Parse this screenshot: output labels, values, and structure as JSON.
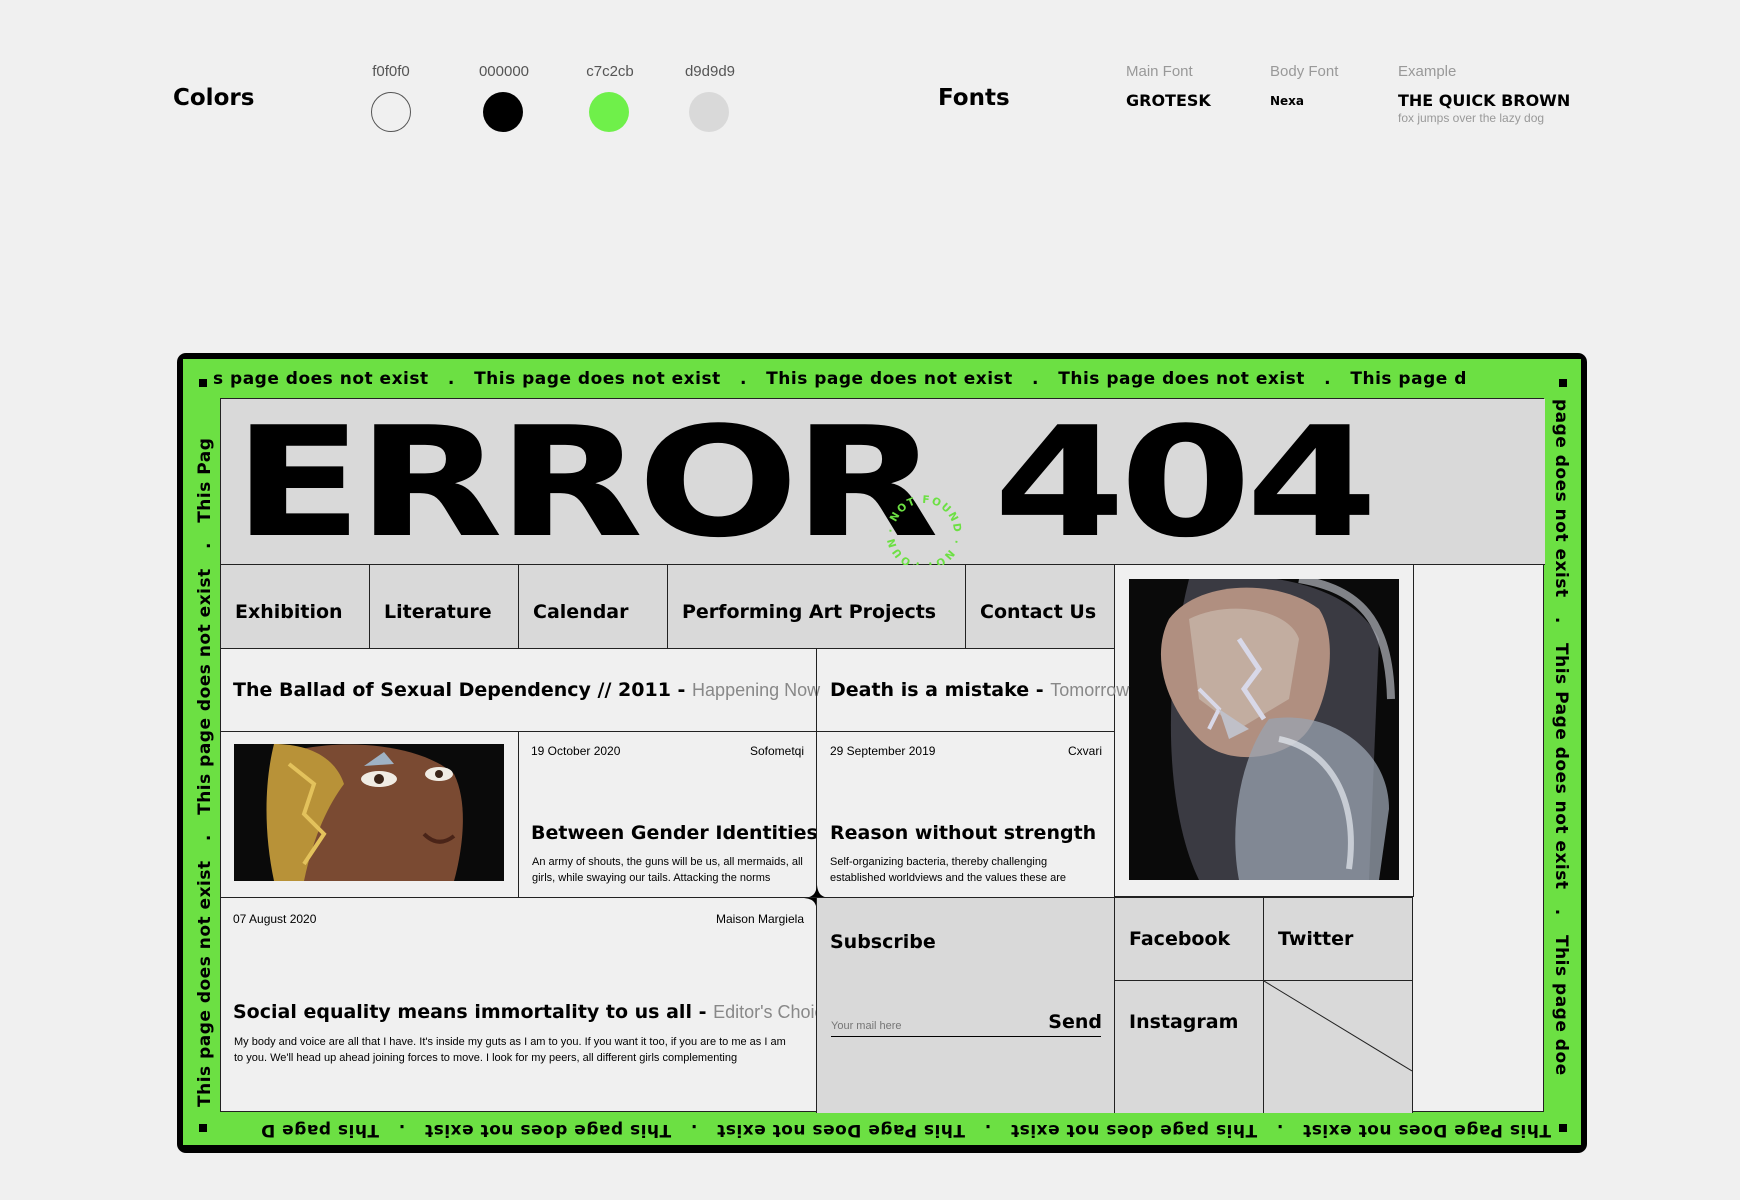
{
  "guide": {
    "colors_title": "Colors",
    "swatches": [
      {
        "label": "f0f0f0",
        "color": "#f0f0f0"
      },
      {
        "label": "000000",
        "color": "#000000"
      },
      {
        "label": "c7c2cb",
        "color": "#6ff04a"
      },
      {
        "label": "d9d9d9",
        "color": "#d9d9d9"
      }
    ],
    "fonts_title": "Fonts",
    "main_font_label": "Main Font",
    "main_font_value": "GROTESK",
    "body_font_label": "Body Font",
    "body_font_value": "Nexa",
    "example_label": "Example",
    "example_heading": "THE QUICK BROWN",
    "example_body": "fox jumps over the lazy dog"
  },
  "poster": {
    "ticker_phrase": "This page does not exist",
    "ticker_top": "s page does not exist   .   This page does not exist   .   This page does not exist   .   This page does not exist   .   This page d",
    "ticker_left": "This page does not exist   .   This page does not exist   .   This Pag",
    "ticker_right": "page does not exist   .   This Page does not exist   .   This page doe",
    "ticker_bottom": "This Page Does not exist   .   This page does not exist   .   This Page Does not exist   .   This page does not exist   .   This page D",
    "title": "ERROR 404",
    "badge_text": "· NOT FOUND · NOT FOUND",
    "accent": "#6ce043",
    "nav": [
      "Exhibition",
      "Literature",
      "Calendar",
      "Performing Art Projects",
      "Contact Us"
    ],
    "headline_1": {
      "title": "The Ballad of Sexual Dependency // 2011 -",
      "tag": "Happening Now"
    },
    "headline_2": {
      "title": "Death is a mistake -",
      "tag": "Tomorrow"
    },
    "card_1": {
      "date": "19 October 2020",
      "author": "Sofometqi",
      "title": "Between Gender Identities",
      "text": "An army of shouts, the guns will be us, all mermaids, all girls, while swaying our tails. Attacking the norms"
    },
    "card_2": {
      "date": "29 September 2019",
      "author": "Cxvari",
      "title": "Reason without strength",
      "text": "Self-organizing bacteria, thereby challenging established worldviews and the values these are"
    },
    "feature": {
      "date": "07 August 2020",
      "author": "Maison Margiela",
      "title": "Social equality means immortality to us all -",
      "tag": "Editor's Choice",
      "text": "My body and voice are all that I have. It's inside my guts as I am to you. If you want it too, if you are to me as I am to you. We'll head up ahead joining forces to move. I look for my peers, all different girls complementing"
    },
    "subscribe": {
      "title": "Subscribe",
      "placeholder": "Your mail here",
      "send": "Send"
    },
    "social": [
      "Facebook",
      "Twitter",
      "Instagram"
    ]
  }
}
